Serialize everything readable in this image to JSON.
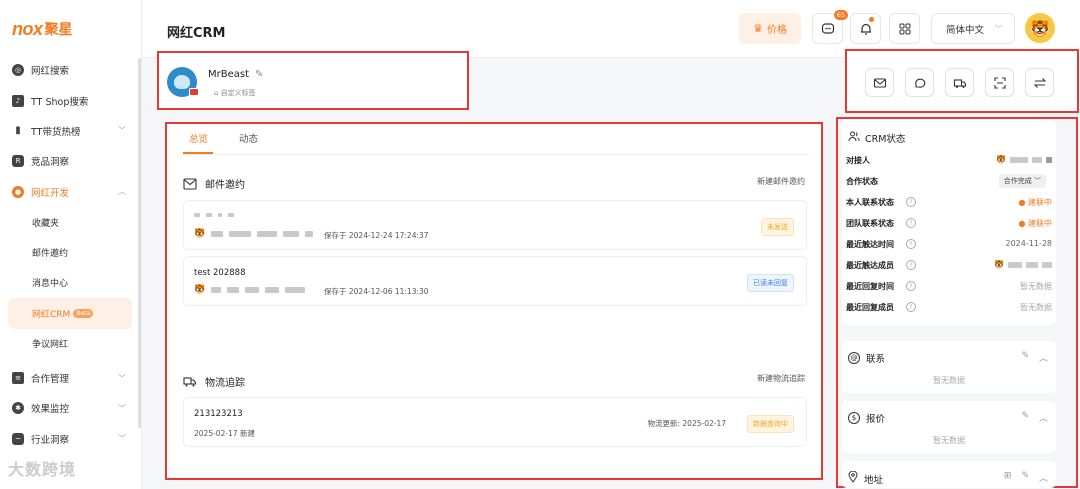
{
  "brand": {
    "logo_text": "nox",
    "logo_cn": "聚星",
    "accent": "#f47a1f"
  },
  "sidebar": {
    "items": [
      {
        "label": "网红搜索",
        "icon": "compass-icon"
      },
      {
        "label": "TT Shop搜索",
        "icon": "shop-bag-icon"
      },
      {
        "label": "TT带货热榜",
        "icon": "bar-chart-icon"
      },
      {
        "label": "竞品洞察",
        "icon": "r-badge-icon"
      },
      {
        "label": "网红开发",
        "icon": "users-icon"
      },
      {
        "label": "收藏夹"
      },
      {
        "label": "邮件邀约"
      },
      {
        "label": "消息中心"
      },
      {
        "label": "网红CRM",
        "badge": "Beta"
      },
      {
        "label": "争议网红"
      },
      {
        "label": "合作管理",
        "icon": "doc-icon"
      },
      {
        "label": "效果监控",
        "icon": "gear-icon"
      },
      {
        "label": "行业洞察",
        "icon": "trend-icon"
      }
    ]
  },
  "header": {
    "title": "网红CRM",
    "price_label": "价格",
    "message_count": "65",
    "language": "简体中文"
  },
  "profile": {
    "name": "MrBeast",
    "tag_label": "自定义标签"
  },
  "tabs": [
    {
      "label": "总览"
    },
    {
      "label": "动态"
    }
  ],
  "email_section": {
    "title": "邮件邀约",
    "new_link": "新建邮件邀约",
    "items": [
      {
        "title": "",
        "saved": "保存于 2024-12-24 17:24:37",
        "status": "未发送"
      },
      {
        "title": "test 202888",
        "saved": "保存于 2024-12-06 11:13:30",
        "status": "已读未回复"
      }
    ]
  },
  "logistics_section": {
    "title": "物流追踪",
    "new_link": "新建物流追踪",
    "item": {
      "number": "213123213",
      "created": "2025-02-17 新建",
      "updated": "物流更新: 2025-02-17",
      "status": "数据查询中"
    }
  },
  "crm": {
    "title": "CRM状态",
    "rows": [
      {
        "label": "对接人",
        "value": ""
      },
      {
        "label": "合作状态",
        "value": "合作完成"
      },
      {
        "label": "本人联系状态",
        "value": "建联中"
      },
      {
        "label": "团队联系状态",
        "value": "建联中"
      },
      {
        "label": "最近触达时间",
        "value": "2024-11-28"
      },
      {
        "label": "最近触达成员",
        "value": ""
      },
      {
        "label": "最近回复时间",
        "value": "暂无数据"
      },
      {
        "label": "最近回复成员",
        "value": "暂无数据"
      }
    ],
    "contact": {
      "title": "联系",
      "empty": "暂无数据"
    },
    "quote": {
      "title": "报价",
      "empty": "暂无数据"
    },
    "address": {
      "title": "地址"
    }
  },
  "watermark": "大数跨境"
}
